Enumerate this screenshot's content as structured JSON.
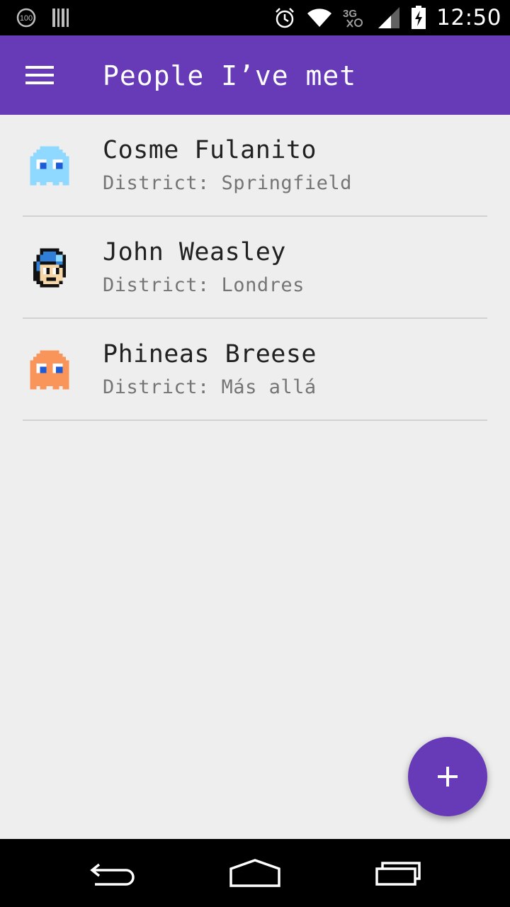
{
  "status_bar": {
    "time": "12:50",
    "notification_badge": "100",
    "network_type": "3G",
    "icons": [
      "notification-100-icon",
      "barcode-icon",
      "alarm-icon",
      "wifi-icon",
      "network-3g-icon",
      "signal-icon",
      "battery-charging-icon"
    ]
  },
  "app_bar": {
    "title": "People I’ve met",
    "menu_icon": "hamburger-menu-icon",
    "color": "#673ab7"
  },
  "people": [
    {
      "name": "Cosme Fulanito",
      "district": "District: Springfield",
      "avatar": "blue-ghost-icon",
      "avatar_color": "#8fd8ff"
    },
    {
      "name": "John Weasley",
      "district": "District: Londres",
      "avatar": "megaman-icon",
      "avatar_color": "#2f7fd8"
    },
    {
      "name": "Phineas Breese",
      "district": "District: Más allá",
      "avatar": "orange-ghost-icon",
      "avatar_color": "#f9955a"
    }
  ],
  "fab": {
    "icon": "plus-icon",
    "color": "#673ab7"
  },
  "nav_bar": {
    "icons": [
      "back-icon",
      "home-icon",
      "recents-icon"
    ]
  }
}
